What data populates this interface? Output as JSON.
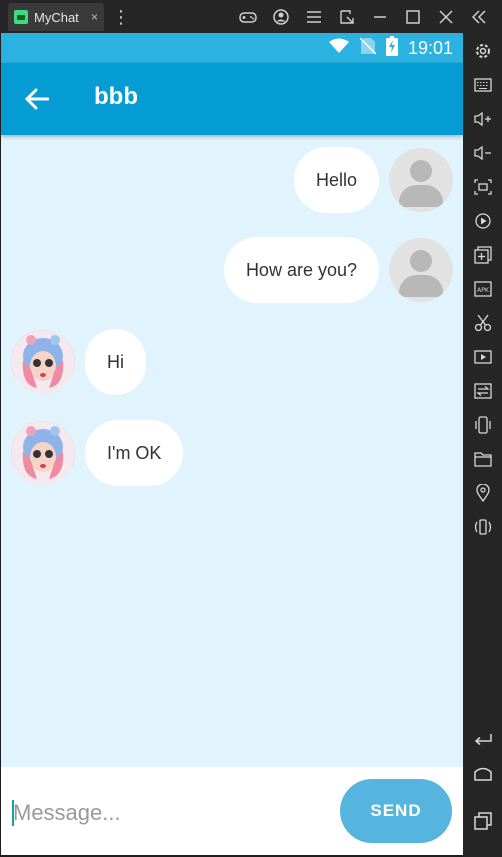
{
  "emulator": {
    "tab_title": "MyChat",
    "tab_close": "×",
    "menu_glyph": "⋮",
    "toolbar_icons": [
      "gamepad-icon",
      "account-icon",
      "menu-icon",
      "resize-icon",
      "minimize-icon",
      "maximize-icon",
      "close-icon",
      "collapse-icon"
    ],
    "sidebar_icons": [
      "settings-icon",
      "keyboard-icon",
      "volume-up-icon",
      "volume-down-icon",
      "screenshot-icon",
      "record-icon",
      "add-window-icon",
      "apk-icon",
      "cut-icon",
      "video-icon",
      "transfer-icon",
      "shake-icon",
      "folder-icon",
      "location-icon",
      "rotate-icon",
      "back-icon",
      "home-icon",
      "recents-icon"
    ]
  },
  "status_bar": {
    "time": "19:01"
  },
  "app_bar": {
    "title": "bbb"
  },
  "messages": [
    {
      "side": "right",
      "text": "Hello",
      "avatar": "default-avatar"
    },
    {
      "side": "right",
      "text": "How are you?",
      "avatar": "default-avatar"
    },
    {
      "side": "left",
      "text": "Hi",
      "avatar": "user-avatar"
    },
    {
      "side": "left",
      "text": "I'm OK",
      "avatar": "user-avatar"
    }
  ],
  "input": {
    "placeholder": "Message...",
    "value": ""
  },
  "send_button": {
    "label": "SEND"
  },
  "colors": {
    "status_bar": "#2cb2e0",
    "app_bar": "#049cd2",
    "chat_bg": "#e1f4fd",
    "send_button": "#56b5de"
  }
}
